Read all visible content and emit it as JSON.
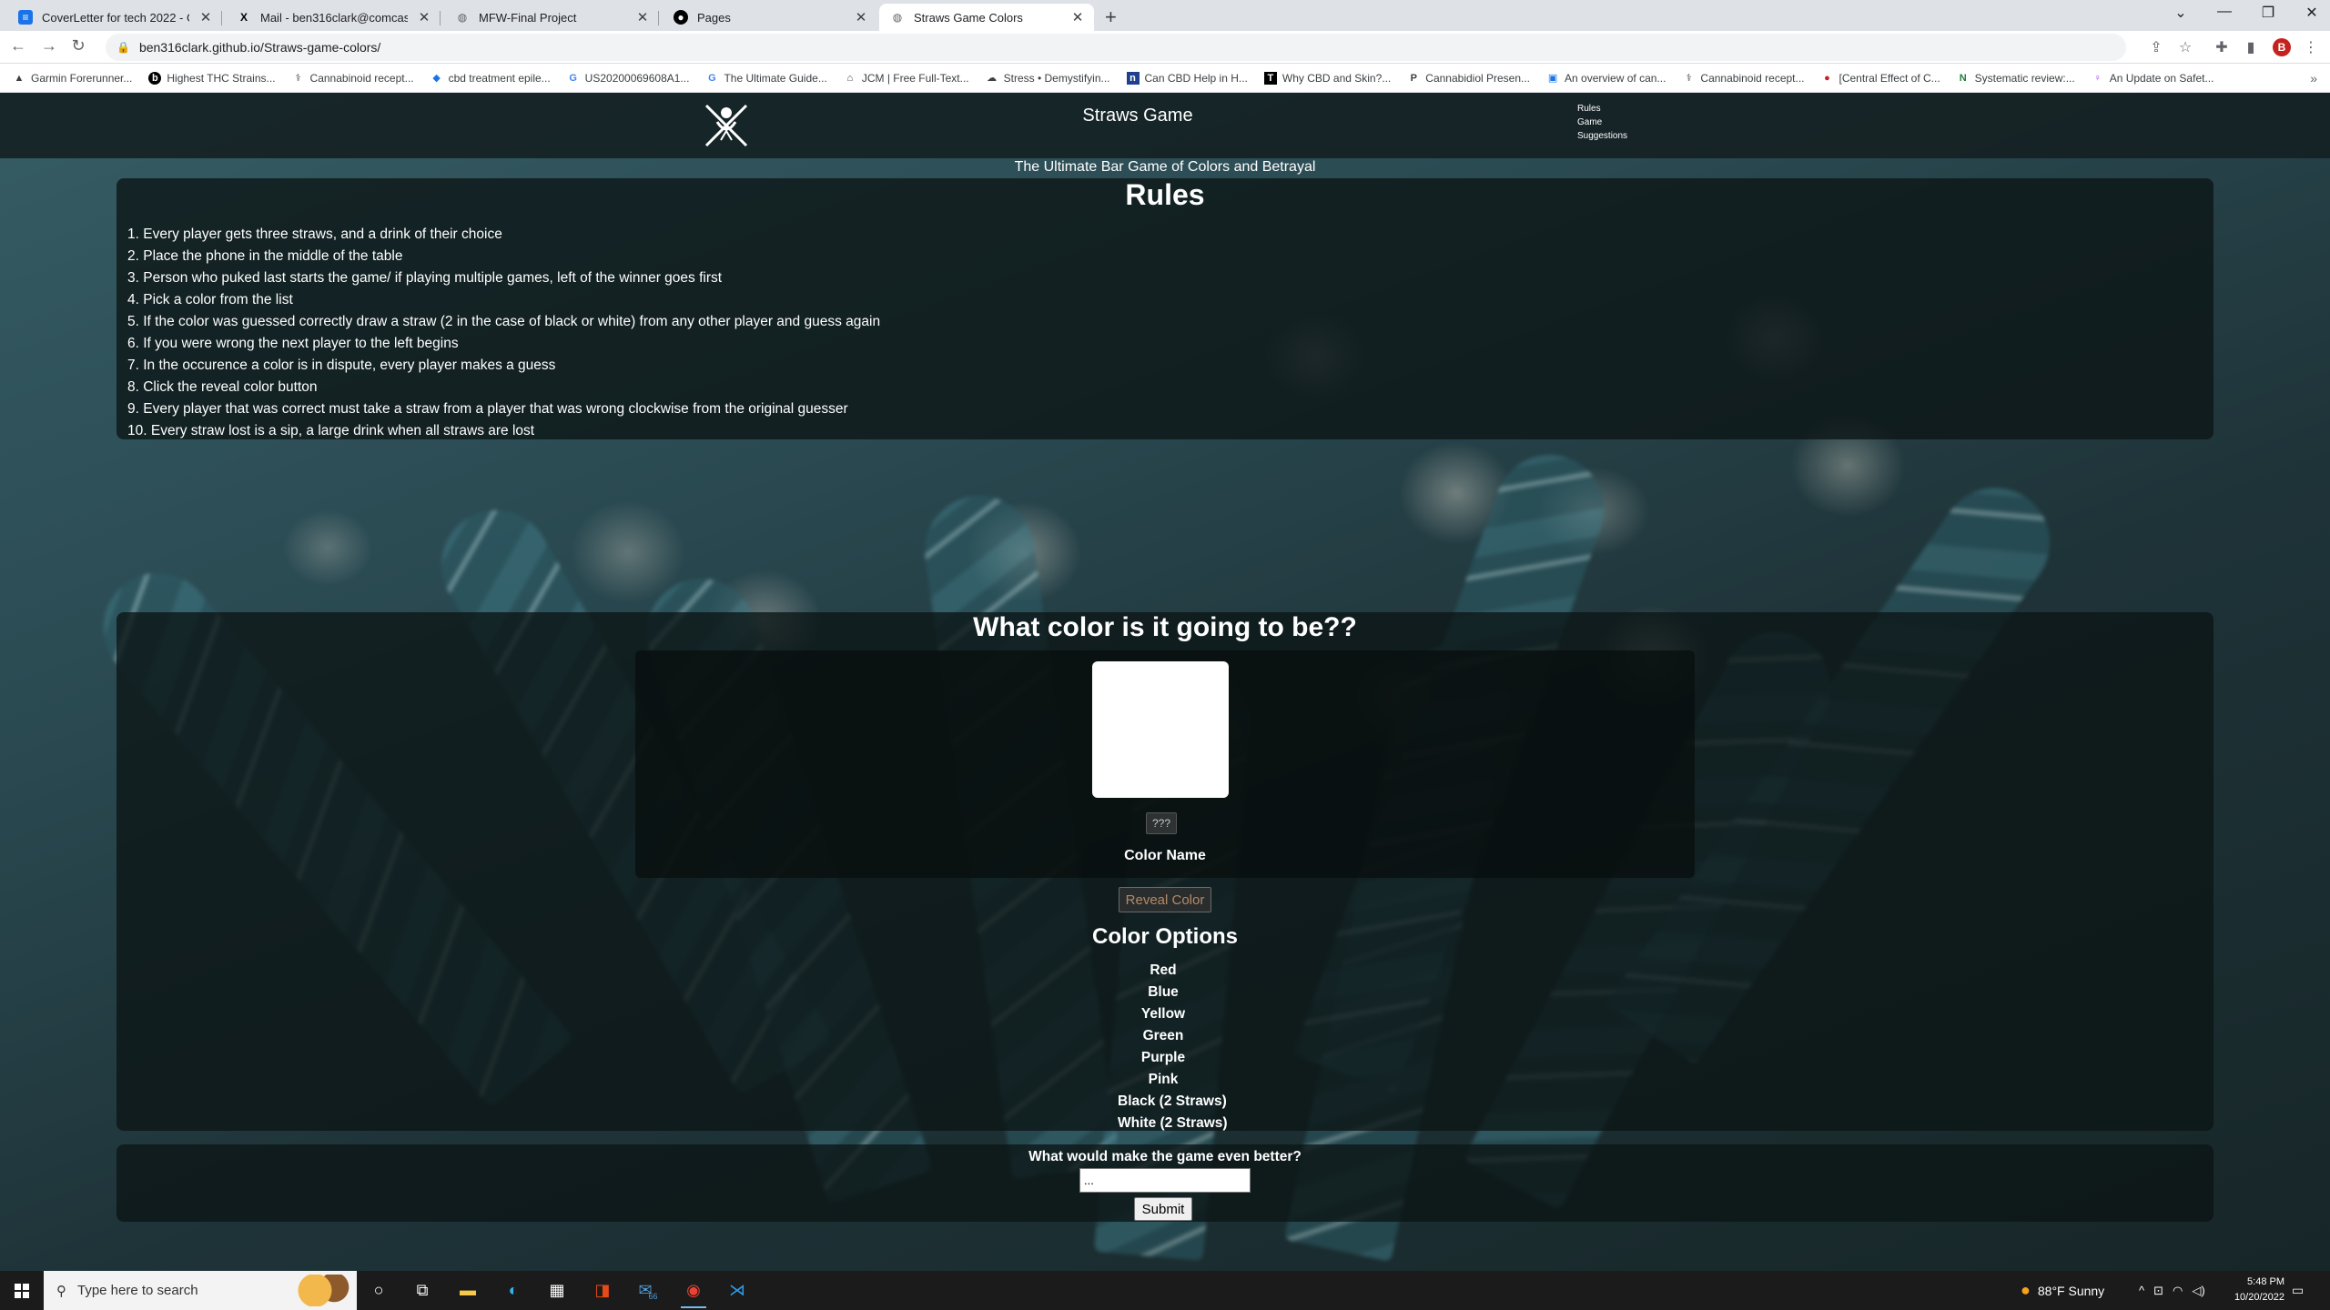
{
  "browser": {
    "tabs": [
      {
        "title": "CoverLetter for tech 2022 - Goog",
        "icon": "google-docs-icon",
        "color": "#1a73e8"
      },
      {
        "title": "Mail - ben316clark@comcast.ne",
        "icon": "xfinity-icon",
        "color": "#000000"
      },
      {
        "title": "MFW-Final Project",
        "icon": "globe-icon",
        "color": "#5f6368"
      },
      {
        "title": "Pages",
        "icon": "github-icon",
        "color": "#000000"
      },
      {
        "title": "Straws Game Colors",
        "icon": "globe-icon",
        "color": "#5f6368"
      }
    ],
    "active_tab_index": 4,
    "url": "ben316clark.github.io/Straws-game-colors/",
    "profile_initial": "B",
    "bookmarks": [
      {
        "label": "Garmin Forerunner...",
        "icon": "garmin-icon"
      },
      {
        "label": "Highest THC Strains...",
        "icon": "leafly-icon"
      },
      {
        "label": "Cannabinoid recept...",
        "icon": "wiki-icon"
      },
      {
        "label": "cbd treatment epile...",
        "icon": "bookmark-icon"
      },
      {
        "label": "US20200069608A1...",
        "icon": "google-icon"
      },
      {
        "label": "The Ultimate Guide...",
        "icon": "google-icon"
      },
      {
        "label": "JCM | Free Full-Text...",
        "icon": "bookmark-icon"
      },
      {
        "label": "Stress • Demystifyin...",
        "icon": "bookmark-icon"
      },
      {
        "label": "Can CBD Help in H...",
        "icon": "bookmark-icon"
      },
      {
        "label": "Why CBD and Skin?...",
        "icon": "t-icon"
      },
      {
        "label": "Cannabidiol Presen...",
        "icon": "bookmark-icon"
      },
      {
        "label": "An overview of can...",
        "icon": "bookmark-icon"
      },
      {
        "label": "Cannabinoid recept...",
        "icon": "wiki-icon"
      },
      {
        "label": "[Central Effect of C...",
        "icon": "bookmark-icon"
      },
      {
        "label": "Systematic review:...",
        "icon": "n-icon"
      },
      {
        "label": "An Update on Safet...",
        "icon": "bookmark-icon"
      }
    ]
  },
  "site": {
    "title": "Straws Game",
    "nav": [
      "Rules",
      "Game",
      "Suggestions"
    ],
    "subtitle": "The Ultimate Bar Game of Colors and Betrayal"
  },
  "rules": {
    "title": "Rules",
    "items": [
      "1. Every player gets three straws, and a drink of their choice",
      "2. Place the phone in the middle of the table",
      "3. Person who puked last starts the game/ if playing multiple games, left of the winner goes first",
      "4. Pick a color from the list",
      "5. If the color was guessed correctly draw a straw (2 in the case of black or white) from any other player and guess again",
      "6. If you were wrong the next player to the left begins",
      "7. In the occurence a color is in dispute, every player makes a guess",
      "8. Click the reveal color button",
      "9. Every player that was correct must take a straw from a player that was wrong clockwise from the original guesser",
      "10. Every straw lost is a sip, a large drink when all straws are lost"
    ]
  },
  "game": {
    "title": "What color is it going to be??",
    "swatch_color": "#ffffff",
    "qq_label": "???",
    "color_name": "Color Name",
    "reveal_label": "Reveal Color",
    "options_title": "Color Options",
    "options": [
      "Red",
      "Blue",
      "Yellow",
      "Green",
      "Purple",
      "Pink",
      "Black (2 Straws)",
      "White (2 Straws)"
    ]
  },
  "suggestions": {
    "label": "What would make the game even better?",
    "value": "...",
    "submit_label": "Submit"
  },
  "taskbar": {
    "search_placeholder": "Type here to search",
    "weather": "88°F  Sunny",
    "time": "5:48 PM",
    "date": "10/20/2022",
    "mail_badge": "66"
  }
}
